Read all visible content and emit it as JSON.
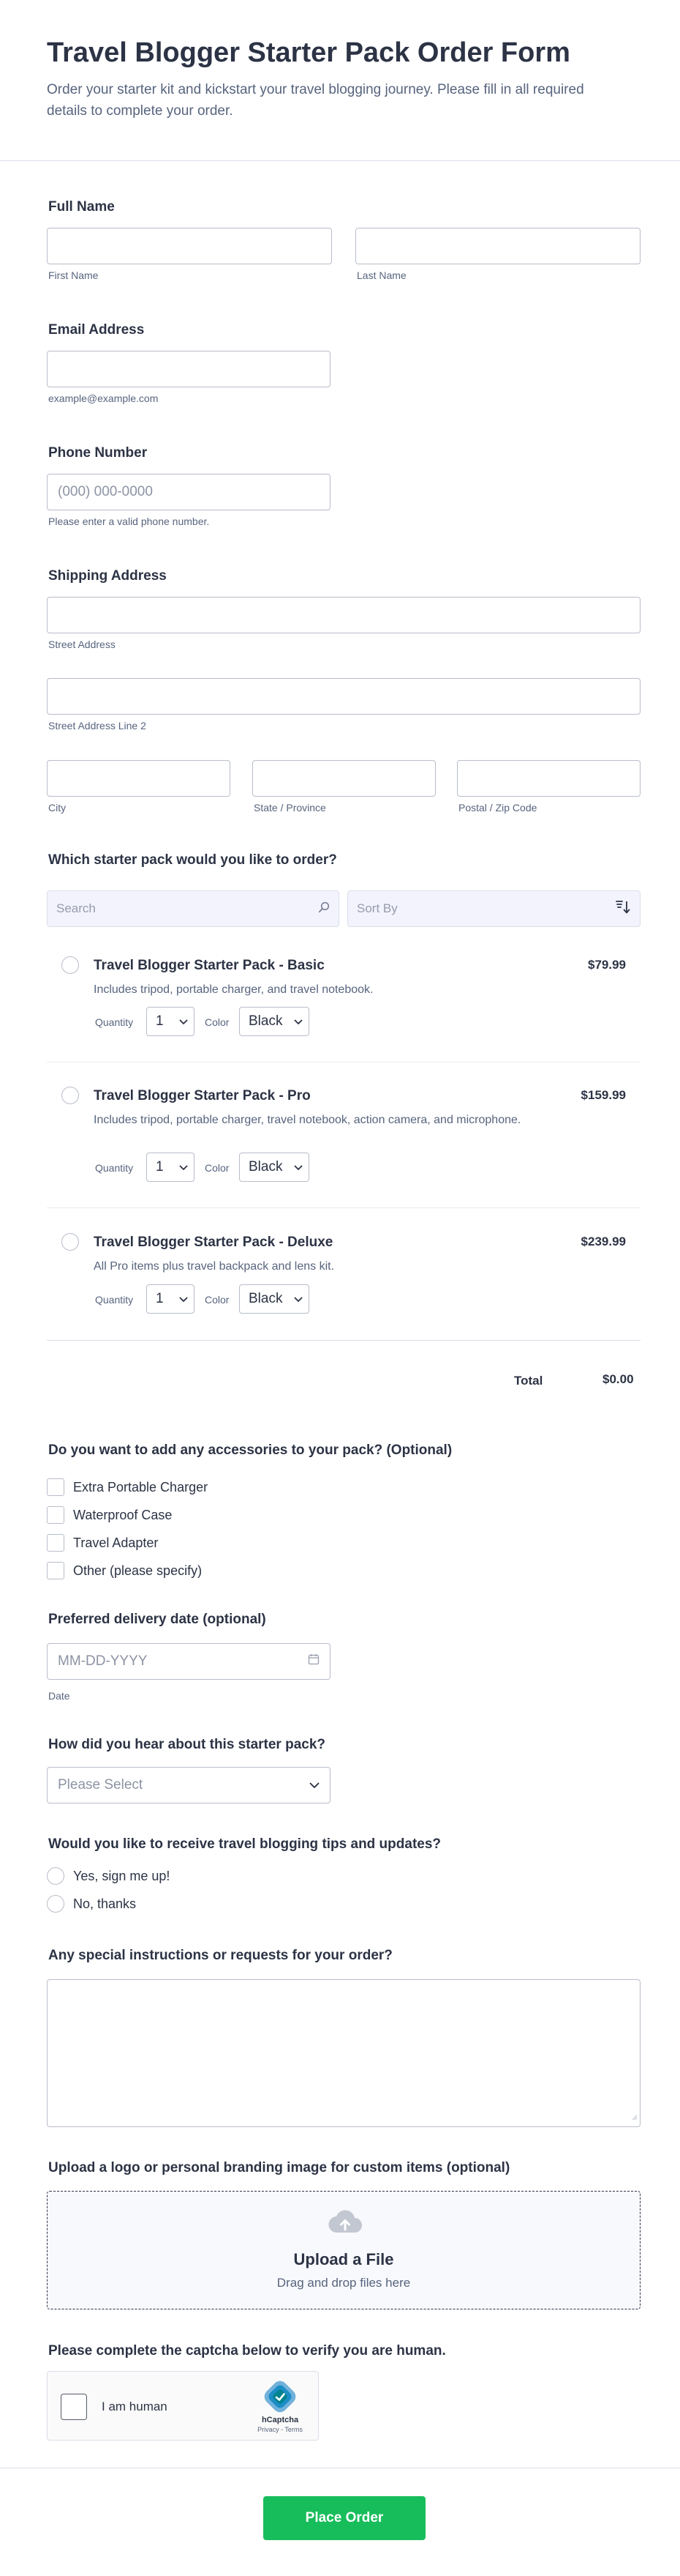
{
  "header": {
    "title": "Travel Blogger Starter Pack Order Form",
    "description": "Order your starter kit and kickstart your travel blogging journey. Please fill in all required details to complete your order."
  },
  "full_name": {
    "label": "Full Name",
    "first_sub": "First Name",
    "last_sub": "Last Name"
  },
  "email": {
    "label": "Email Address",
    "sub": "example@example.com"
  },
  "phone": {
    "label": "Phone Number",
    "placeholder": "(000) 000-0000",
    "sub": "Please enter a valid phone number."
  },
  "address": {
    "label": "Shipping Address",
    "street_sub": "Street Address",
    "street2_sub": "Street Address Line 2",
    "city_sub": "City",
    "state_sub": "State / Province",
    "zip_sub": "Postal / Zip Code"
  },
  "products": {
    "label": "Which starter pack would you like to order?",
    "search_placeholder": "Search",
    "sort_label": "Sort By",
    "quantity_label": "Quantity",
    "color_label": "Color",
    "items": [
      {
        "name": "Travel Blogger Starter Pack - Basic",
        "desc": "Includes tripod, portable charger, and travel notebook.",
        "price": "$79.99",
        "quantity": "1",
        "color": "Black"
      },
      {
        "name": "Travel Blogger Starter Pack - Pro",
        "desc": "Includes tripod, portable charger, travel notebook, action camera, and microphone.",
        "price": "$159.99",
        "quantity": "1",
        "color": "Black"
      },
      {
        "name": "Travel Blogger Starter Pack - Deluxe",
        "desc": "All Pro items plus travel backpack and lens kit.",
        "price": "$239.99",
        "quantity": "1",
        "color": "Black"
      }
    ],
    "total_label": "Total",
    "total_value": "$0.00"
  },
  "accessories": {
    "label": "Do you want to add any accessories to your pack? (Optional)",
    "options": [
      "Extra Portable Charger",
      "Waterproof Case",
      "Travel Adapter",
      "Other (please specify)"
    ]
  },
  "delivery": {
    "label": "Preferred delivery date (optional)",
    "placeholder": "MM-DD-YYYY",
    "sub": "Date"
  },
  "referral": {
    "label": "How did you hear about this starter pack?",
    "placeholder": "Please Select"
  },
  "tips": {
    "label": "Would you like to receive travel blogging tips and updates?",
    "options": [
      "Yes, sign me up!",
      "No, thanks"
    ]
  },
  "instructions": {
    "label": "Any special instructions or requests for your order?"
  },
  "upload": {
    "label": "Upload a logo or personal branding image for custom items (optional)",
    "title": "Upload a File",
    "sub": "Drag and drop files here"
  },
  "captcha": {
    "label": "Please complete the captcha below to verify you are human.",
    "checkbox_text": "I am human",
    "brand": "hCaptcha",
    "links": "Privacy - Terms"
  },
  "submit_label": "Place Order",
  "colors": {
    "primary_text": "#2c3345",
    "secondary_text": "#57647e",
    "border": "#b8bdc9",
    "submit": "#18bd5b",
    "toolbar_bg": "#f3f3fe"
  },
  "icons": [
    "search-icon",
    "sort-icon",
    "chevron-down-icon",
    "calendar-icon",
    "upload-cloud-icon",
    "hcaptcha-logo"
  ]
}
